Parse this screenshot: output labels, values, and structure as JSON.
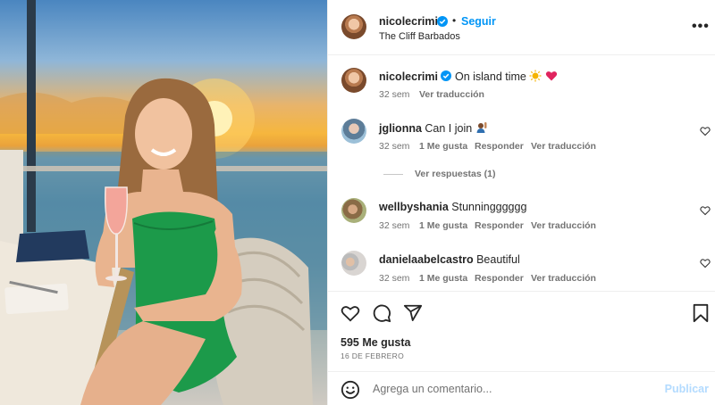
{
  "post": {
    "photo_alt_icon": "post-photo",
    "header": {
      "username": "nicolecrimi",
      "separator": "•",
      "follow_label": "Seguir",
      "location": "The Cliff Barbados",
      "more_icon": "more-horizontal-icon",
      "more_label": "•••"
    },
    "caption": {
      "username": "nicolecrimi",
      "text": "On island time",
      "emoji_icons": [
        "sun-emoji",
        "heart-emoji"
      ],
      "time": "32 sem",
      "translate": "Ver traducción"
    },
    "comments": [
      {
        "username": "jglionna",
        "text": "Can I join",
        "emoji_icon": "raising-hand-emoji",
        "time": "32 sem",
        "likes": "1 Me gusta",
        "reply": "Responder",
        "translate": "Ver traducción",
        "replies": "Ver respuestas (1)"
      },
      {
        "username": "wellbyshania",
        "text": "Stunningggggg",
        "time": "32 sem",
        "likes": "1 Me gusta",
        "reply": "Responder",
        "translate": "Ver traducción"
      },
      {
        "username": "danielaabelcastro",
        "text": "Beautiful",
        "time": "32 sem",
        "likes": "1 Me gusta",
        "reply": "Responder",
        "translate": "Ver traducción"
      }
    ],
    "actions": {
      "like_icon": "heart-icon",
      "comment_icon": "comment-icon",
      "share_icon": "share-icon",
      "save_icon": "bookmark-icon",
      "likes_count": "595 Me gusta",
      "date": "16 DE FEBRERO"
    },
    "comment_bar": {
      "emoji_icon": "emoji-icon",
      "placeholder": "Agrega un comentario...",
      "publish_label": "Publicar"
    },
    "colors": {
      "link_blue": "#0095f6",
      "publish_disabled": "#b3dbff",
      "verified_blue": "#0095f6",
      "secondary_text": "#737373",
      "dress_green": "#1c9a4a"
    }
  }
}
